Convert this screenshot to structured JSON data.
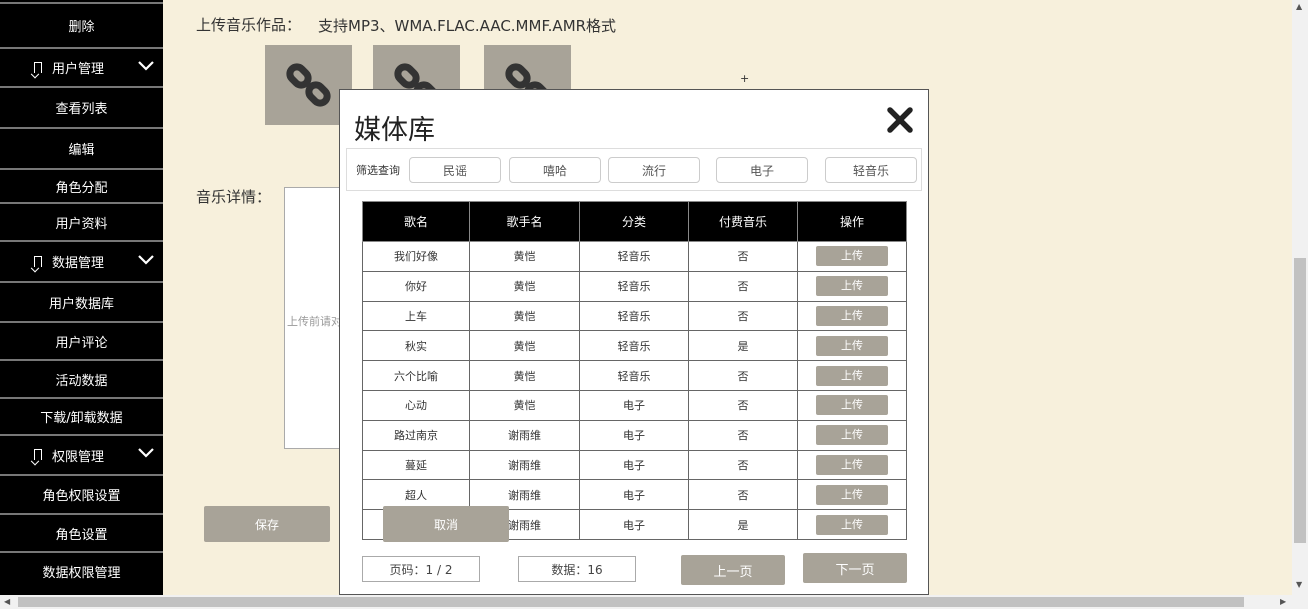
{
  "sidebar": {
    "items": [
      {
        "label": "删除",
        "type": "item"
      },
      {
        "label": "用户管理",
        "type": "group"
      },
      {
        "label": "查看列表",
        "type": "item"
      },
      {
        "label": "编辑",
        "type": "item"
      },
      {
        "label": "角色分配",
        "type": "item"
      },
      {
        "label": "用户资料",
        "type": "item"
      },
      {
        "label": "数据管理",
        "type": "group"
      },
      {
        "label": "用户数据库",
        "type": "item"
      },
      {
        "label": "用户评论",
        "type": "item"
      },
      {
        "label": "活动数据",
        "type": "item"
      },
      {
        "label": "下载/卸载数据",
        "type": "item"
      },
      {
        "label": "权限管理",
        "type": "group"
      },
      {
        "label": "角色权限设置",
        "type": "item"
      },
      {
        "label": "角色设置",
        "type": "item"
      },
      {
        "label": "数据权限管理",
        "type": "item"
      }
    ]
  },
  "form": {
    "upload_label": "上传音乐作品：",
    "upload_formats": "支持MP3、WMA.FLAC.AAC.MMF.AMR格式",
    "plus": "+",
    "detail_label": "音乐详情：",
    "detail_placeholder": "上传前请对",
    "save_label": "保存",
    "cancel_label": "取消"
  },
  "modal": {
    "title": "媒体库",
    "filter_label": "筛选查询",
    "filters": [
      "民谣",
      "嘻哈",
      "流行",
      "电子",
      "轻音乐"
    ],
    "columns": [
      "歌名",
      "歌手名",
      "分类",
      "付费音乐",
      "操作"
    ],
    "rows": [
      [
        "我们好像",
        "黄恺",
        "轻音乐",
        "否",
        "上传"
      ],
      [
        "你好",
        "黄恺",
        "轻音乐",
        "否",
        "上传"
      ],
      [
        "上车",
        "黄恺",
        "轻音乐",
        "否",
        "上传"
      ],
      [
        "秋实",
        "黄恺",
        "轻音乐",
        "是",
        "上传"
      ],
      [
        "六个比喻",
        "黄恺",
        "轻音乐",
        "否",
        "上传"
      ],
      [
        "心动",
        "黄恺",
        "电子",
        "否",
        "上传"
      ],
      [
        "路过南京",
        "谢雨维",
        "电子",
        "否",
        "上传"
      ],
      [
        "蔓延",
        "谢雨维",
        "电子",
        "否",
        "上传"
      ],
      [
        "超人",
        "谢雨维",
        "电子",
        "否",
        "上传"
      ],
      [
        "",
        "谢雨维",
        "电子",
        "是",
        "上传"
      ]
    ],
    "page_info": "页码：1 / 2",
    "count_info": "数据：16",
    "prev_label": "上一页",
    "next_label": "下一页"
  },
  "colors": {
    "background": "#f7f0dc",
    "sidebar": "#000000",
    "accent_button": "#a8a398"
  },
  "icons": {
    "thumbnail": "link-icon",
    "group": "bookmark-icon",
    "expand": "chevron-down-icon",
    "close": "close-icon"
  }
}
